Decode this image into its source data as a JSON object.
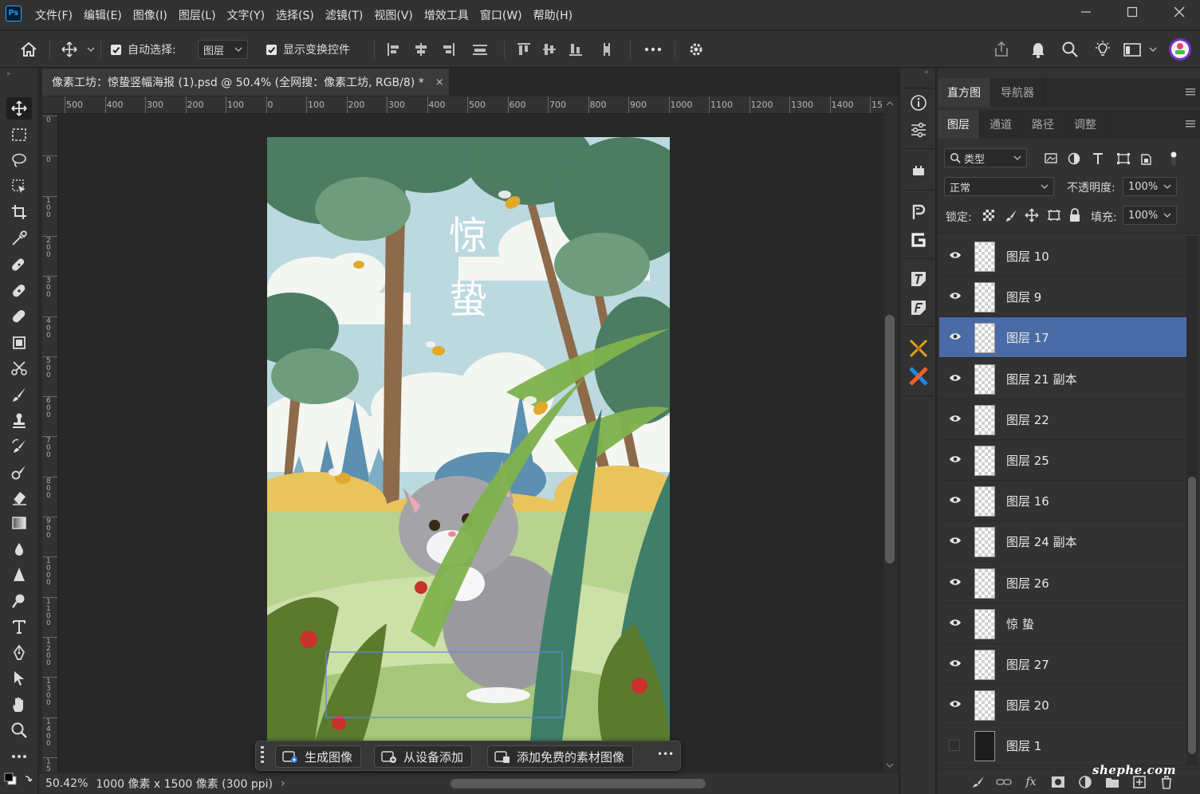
{
  "app": {
    "logo": "Ps"
  },
  "menu": [
    "文件(F)",
    "编辑(E)",
    "图像(I)",
    "图层(L)",
    "文字(Y)",
    "选择(S)",
    "滤镜(T)",
    "视图(V)",
    "增效工具",
    "窗口(W)",
    "帮助(H)"
  ],
  "options": {
    "auto_select_label": "自动选择:",
    "auto_select_checked": true,
    "auto_select_target": "图层",
    "show_transform_label": "显示变换控件",
    "show_transform_checked": true
  },
  "document": {
    "tab_title": "像素工坊：惊蛰竖幅海报 (1).psd @ 50.4% (全网搜：像素工坊, RGB/8) *",
    "close_glyph": "×",
    "poster_title": [
      "惊",
      "蛰"
    ]
  },
  "ruler": {
    "h_labels": [
      "500",
      "400",
      "300",
      "200",
      "100",
      "0",
      "100",
      "200",
      "300",
      "400",
      "500",
      "600",
      "700",
      "800",
      "900",
      "1000",
      "1100",
      "1200",
      "1300",
      "1400",
      "15"
    ],
    "v_labels": [
      "0",
      "0",
      "100",
      "200",
      "300",
      "400",
      "500",
      "600",
      "700",
      "800",
      "900",
      "1000",
      "1100",
      "1200",
      "1300",
      "1400",
      "1500"
    ]
  },
  "status": {
    "zoom": "50.42%",
    "doc_info": "1000 像素 x 1500 像素 (300 ppi)",
    "arrow": "›"
  },
  "taskbar": {
    "generate": "生成图像",
    "add_from_device": "从设备添加",
    "add_free_assets": "添加免费的素材图像",
    "more": "•••"
  },
  "panels": {
    "top_tabs": [
      "直方图",
      "导航器"
    ],
    "layer_tabs": [
      "图层",
      "通道",
      "路径",
      "调整"
    ],
    "filter_label": "类型",
    "blend_mode": "正常",
    "opacity_label": "不透明度:",
    "opacity_value": "100%",
    "lock_label": "锁定:",
    "fill_label": "填充:",
    "fill_value": "100%"
  },
  "layers": [
    {
      "name": "图层 10",
      "visible": true,
      "selected": false
    },
    {
      "name": "图层 9",
      "visible": true,
      "selected": false
    },
    {
      "name": "图层 17",
      "visible": true,
      "selected": true
    },
    {
      "name": "图层 21 副本",
      "visible": true,
      "selected": false
    },
    {
      "name": "图层 22",
      "visible": true,
      "selected": false
    },
    {
      "name": "图层 25",
      "visible": true,
      "selected": false
    },
    {
      "name": "图层 16",
      "visible": true,
      "selected": false
    },
    {
      "name": "图层 24 副本",
      "visible": true,
      "selected": false
    },
    {
      "name": "图层 26",
      "visible": true,
      "selected": false
    },
    {
      "name": "惊 蛰",
      "visible": true,
      "selected": false
    },
    {
      "name": "图层 27",
      "visible": true,
      "selected": false
    },
    {
      "name": "图层 20",
      "visible": true,
      "selected": false
    },
    {
      "name": "图层 1",
      "visible": false,
      "selected": false
    }
  ],
  "footer": {
    "fx_label": "fx"
  },
  "watermark": "shephe.com",
  "colors": {
    "accent_selected": "#4b6ba6",
    "ps_blue": "#31a8ff"
  }
}
